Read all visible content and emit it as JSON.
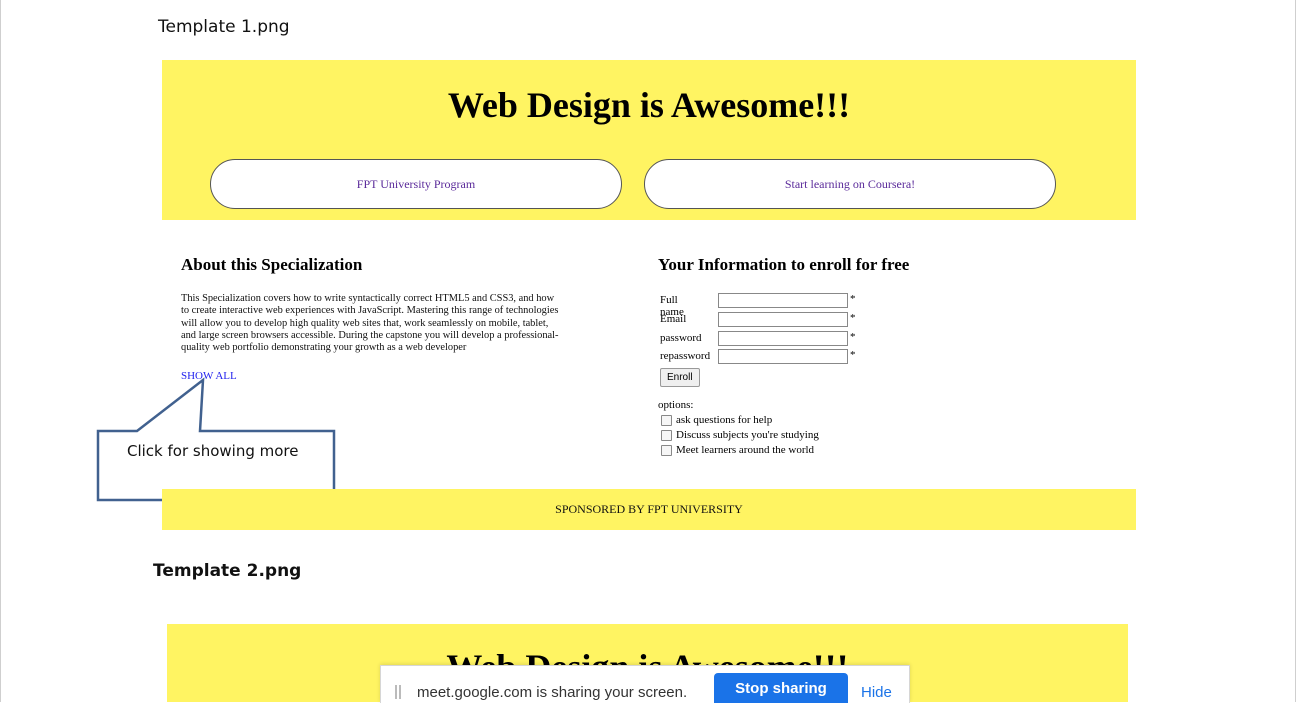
{
  "captions": {
    "template1": "Template 1.png",
    "template2": "Template 2.png"
  },
  "template1": {
    "title": "Web Design is Awesome!!!",
    "nav": {
      "left": "FPT University Program",
      "right": "Start learning on Coursera!"
    },
    "about": {
      "heading": "About this Specialization",
      "lines": [
        "This Specialization covers how to write syntactically correct HTML5 and CSS3, and how",
        "to create interactive web experiences with JavaScript. Mastering this range of technologies",
        "will allow you to develop high quality web sites that, work seamlessly on mobile, tablet,",
        "and large screen browsers accessible. During the capstone you will develop a professional-",
        "quality web portfolio demonstrating your growth as a web developer"
      ],
      "show_all": "SHOW ALL"
    },
    "callout": "Click for showing more",
    "enroll": {
      "heading": "Your Information to enroll for free",
      "fields": [
        "Full name",
        "Email",
        "password",
        "repassword"
      ],
      "required_mark": "*",
      "button": "Enroll",
      "options_label": "options:",
      "options": [
        "ask questions for help",
        "Discuss subjects you're studying",
        "Meet learners around the world"
      ]
    },
    "footer": "SPONSORED BY FPT UNIVERSITY"
  },
  "template2": {
    "title": "Web Design is Awesome!!!"
  },
  "share_bar": {
    "message": "meet.google.com is sharing your screen.",
    "stop": "Stop sharing",
    "hide": "Hide"
  },
  "colors": {
    "yellow": "#fff462",
    "link_blue": "#2222ee",
    "nav_purple": "#5a2a9a",
    "callout_stroke": "#41618f",
    "stop_button": "#1a73e8"
  }
}
